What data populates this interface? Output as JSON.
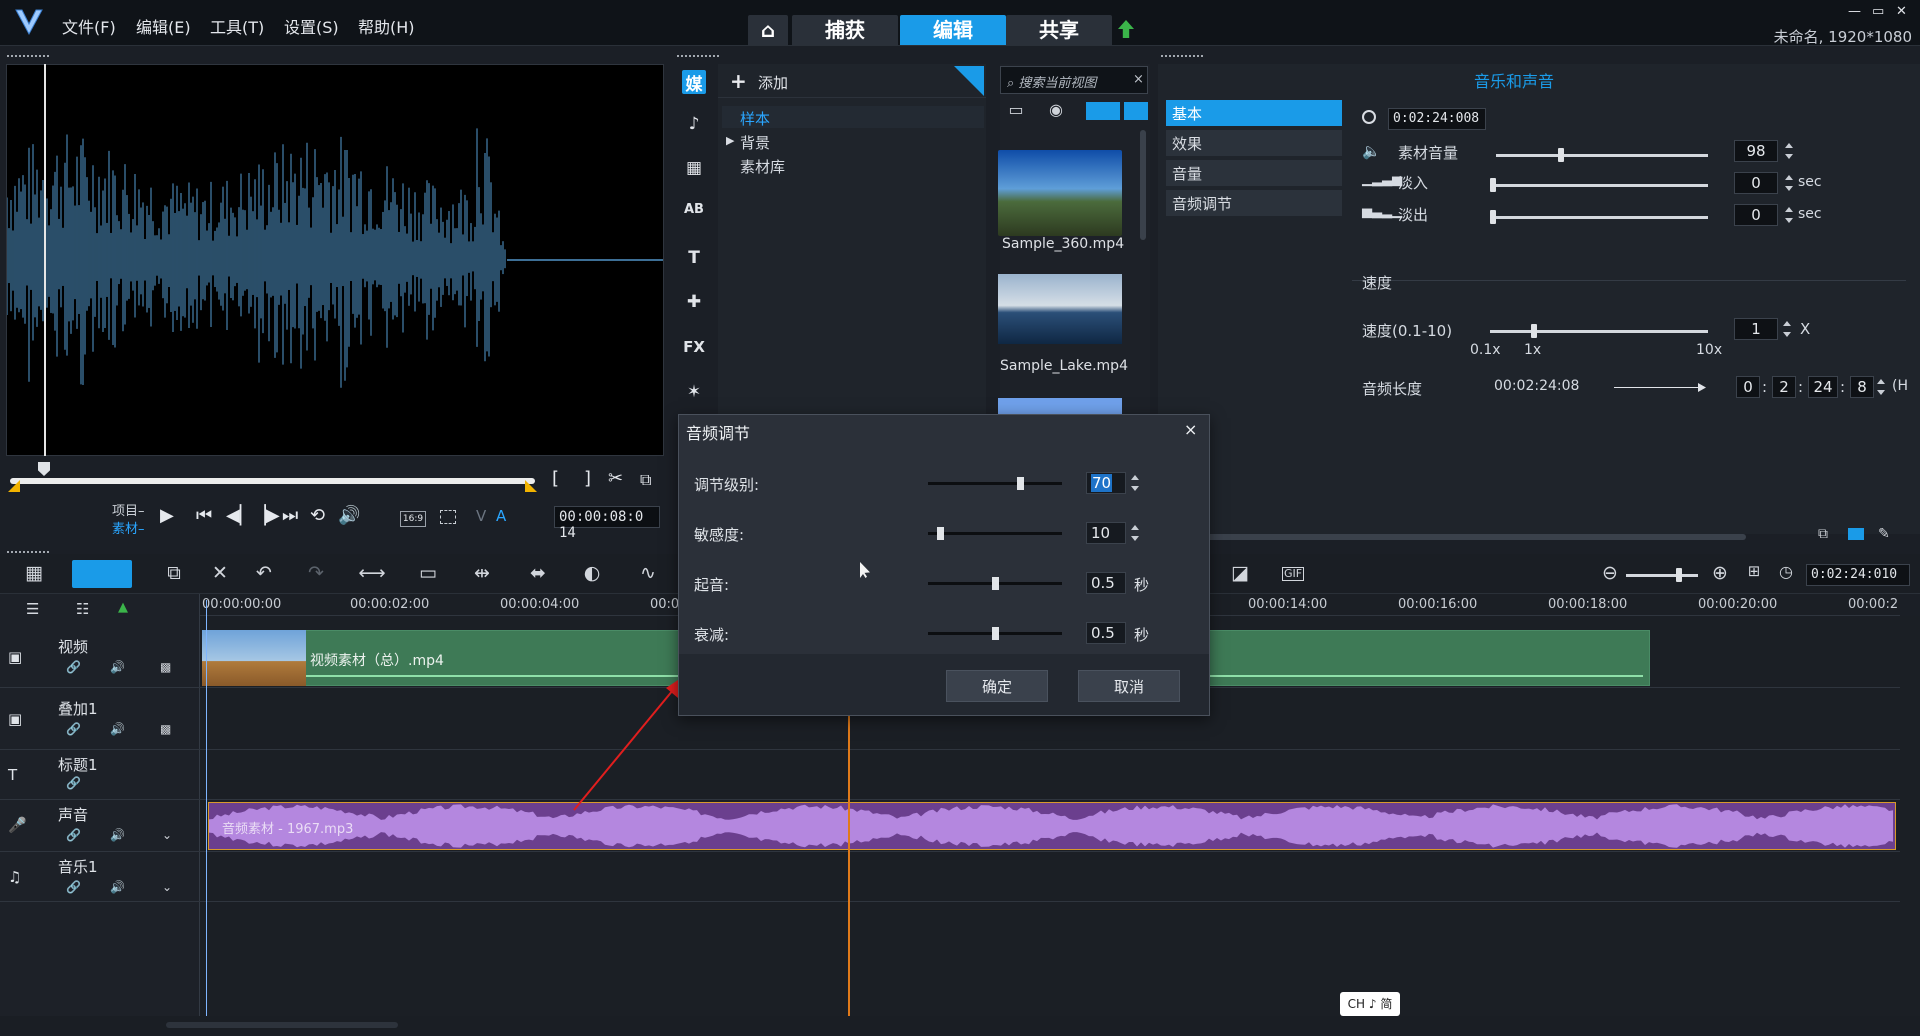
{
  "menu": [
    "文件(F)",
    "编辑(E)",
    "工具(T)",
    "设置(S)",
    "帮助(H)"
  ],
  "mode_tabs": {
    "capture": "捕获",
    "edit": "编辑",
    "share": "共享"
  },
  "project_name": "未命名, 1920*1080",
  "window_controls": {
    "minimize": "—",
    "restore": "▭",
    "close": "✕"
  },
  "preview": {
    "project_label": "项目–",
    "clip_label": "素材–",
    "mark_in": "[",
    "mark_out": "]",
    "aspect": "16:9",
    "timecode": "00:00:08:0 14",
    "letter_v": "V",
    "letter_a": "A"
  },
  "library": {
    "add_label": "添加",
    "tree": [
      "样本",
      "背景",
      "素材库"
    ],
    "search_placeholder": "搜索当前视图",
    "search_clear": "×",
    "thumbnails": [
      "Sample_360.mp4",
      "Sample_Lake.mp4"
    ],
    "rail": [
      "媒",
      "♪",
      "▦",
      "AB",
      "T",
      "✚",
      "FX",
      "✶"
    ]
  },
  "options": {
    "title": "音乐和声音",
    "tabs": [
      "基本",
      "效果",
      "音量",
      "音频调节"
    ],
    "duration": "0:02:24:008",
    "clip_volume_label": "素材音量",
    "clip_volume": "98",
    "clip_volume_level": 98,
    "fade_in_label": "淡入",
    "fade_in": "0",
    "fade_out_label": "淡出",
    "fade_out": "0",
    "sec": "sec",
    "speed_group": "速度",
    "speed_label": "速度(0.1-10)",
    "speed": "1",
    "speed_unit": "X",
    "speed_ticks": [
      "0.1x",
      "1x",
      "10x"
    ],
    "audio_length_label": "音频长度",
    "audio_length": "00:02:24:08",
    "length_fields": [
      "0",
      "2",
      "24",
      "8"
    ],
    "length_trailing": "(H"
  },
  "timeline": {
    "ruler": [
      "00:00:00:00",
      "00:00:02:00",
      "00:00:04:00",
      "00:0",
      "00:00:14:00",
      "00:00:16:00",
      "00:00:18:00",
      "00:00:20:00",
      "00:00:2"
    ],
    "tracks": [
      {
        "name": "视频",
        "icon": "▣"
      },
      {
        "name": "叠加1",
        "icon": "▣"
      },
      {
        "name": "标题1",
        "icon": "T"
      },
      {
        "name": "声音",
        "icon": "🎤"
      },
      {
        "name": "音乐1",
        "icon": "♫"
      }
    ],
    "video_clip": "视频素材（总）.mp4",
    "audio_clip": "音频素材 - 1967.mp3",
    "timecode": "0:02:24:010",
    "ime": "CH ♪ 简"
  },
  "dialog": {
    "title": "音频调节",
    "close": "×",
    "rows": [
      {
        "label": "调节级别:",
        "value": "70",
        "unit": "",
        "level": 0.7
      },
      {
        "label": "敏感度:",
        "value": "10",
        "unit": "",
        "level": 0.07
      },
      {
        "label": "起音:",
        "value": "0.5",
        "unit": "秒",
        "level": 0.5
      },
      {
        "label": "衰减:",
        "value": "0.5",
        "unit": "秒",
        "level": 0.5
      }
    ],
    "ok": "确定",
    "cancel": "取消"
  },
  "colors": {
    "accent": "#1a9be8",
    "video_clip": "#3e7a56",
    "audio_clip": "#6b3f8e",
    "playhead": "#e07a1a"
  }
}
